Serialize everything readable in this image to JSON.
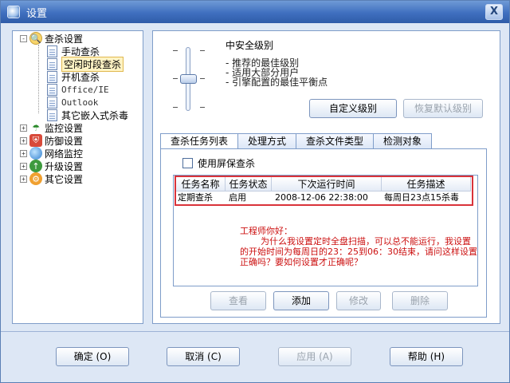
{
  "window": {
    "title": "设置",
    "close_glyph": "X"
  },
  "tree": {
    "scan_settings": "查杀设置",
    "children": [
      "手动查杀",
      "空闲时段查杀",
      "开机查杀",
      "Office/IE",
      "Outlook",
      "其它嵌入式杀毒"
    ],
    "selected_index": 1,
    "roots": [
      "监控设置",
      "防御设置",
      "网络监控",
      "升级设置",
      "其它设置"
    ],
    "expand_minus": "-",
    "expand_plus": "+"
  },
  "security_level": {
    "title": "中安全级别",
    "desc1": "- 推荐的最佳级别",
    "desc2": "- 适用大部分用户",
    "desc3": "- 引擎配置的最佳平衡点",
    "custom_button": "自定义级别",
    "restore_button": "恢复默认级别"
  },
  "tabs": [
    "查杀任务列表",
    "处理方式",
    "查杀文件类型",
    "检测对象"
  ],
  "screensaver_label": "使用屏保查杀",
  "table": {
    "headers": [
      "任务名称",
      "任务状态",
      "下次运行时间",
      "任务描述"
    ],
    "row": [
      "定期查杀",
      "启用",
      "2008-12-06 22:38:00",
      "每周日23点15杀毒"
    ]
  },
  "note": {
    "line1": "工程师你好：",
    "line2": "为什么我设置定时全盘扫描，可以总不能运行，我设置的开始时间为每周日的23：25到06：30结束，请问这样设置正确吗？要如何设置才正确呢？"
  },
  "task_buttons": {
    "view": "查看",
    "add": "添加",
    "edit": "修改",
    "delete": "删除"
  },
  "footer": {
    "ok": "确定 (O)",
    "cancel": "取消 (C)",
    "apply": "应用 (A)",
    "help": "帮助 (H)"
  }
}
